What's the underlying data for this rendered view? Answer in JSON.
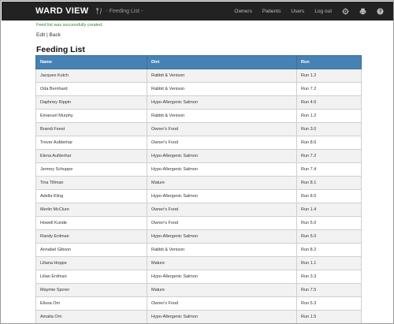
{
  "navbar": {
    "brand": "WARD VIEW",
    "breadcrumb": "- Feeding List -",
    "links": [
      "Owners",
      "Patients",
      "Users",
      "Log out"
    ]
  },
  "flash": "Feed list was successfully created.",
  "actions": {
    "edit": "Edit",
    "separator": "|",
    "back": "Back"
  },
  "page_title": "Feeding List",
  "table": {
    "headers": [
      "Name",
      "Diet",
      "Run"
    ],
    "rows": [
      [
        "Jacques Kutch",
        "Rabbit & Venison",
        "Run 1.2"
      ],
      [
        "Oda Bernhard",
        "Rabbit & Venison",
        "Run 7.2"
      ],
      [
        "Daphney Rippin",
        "Hypo-Allergenic Salmon",
        "Run 4.6"
      ],
      [
        "Emanuel Murphy",
        "Rabbit & Venison",
        "Run 1.2"
      ],
      [
        "Brandi Feest",
        "Owner's Food",
        "Run 3.0"
      ],
      [
        "Trever Aufderhar",
        "Owner's Food",
        "Run 8.6"
      ],
      [
        "Elena Aufderhar",
        "Hypo-Allergenic Salmon",
        "Run 7.2"
      ],
      [
        "Jermey Schuppe",
        "Hypo-Allergenic Salmon",
        "Run 7.4"
      ],
      [
        "Tina Tillman",
        "Mature",
        "Run 8.1"
      ],
      [
        "Adella Kling",
        "Hypo-Allergenic Salmon",
        "Run 8.5"
      ],
      [
        "Merlin McClure",
        "Owner's Food",
        "Run 1.4"
      ],
      [
        "Howell Kunde",
        "Owner's Food",
        "Run 5.0"
      ],
      [
        "Randy Erdman",
        "Hypo-Allergenic Salmon",
        "Run 5.0"
      ],
      [
        "Annabel Gibson",
        "Rabbit & Venison",
        "Run 8.2"
      ],
      [
        "Liliana Hoppe",
        "Mature",
        "Run 1.1"
      ],
      [
        "Lilian Erdman",
        "Hypo-Allergenic Salmon",
        "Run 3.3"
      ],
      [
        "Maymie Sporer",
        "Mature",
        "Run 7.5"
      ],
      [
        "Elissa Orn",
        "Owner's Food",
        "Run 5.3"
      ],
      [
        "Amalia Orn",
        "Hypo-Allergenic Salmon",
        "Run 1.5"
      ]
    ]
  },
  "colors": {
    "navbar": "#222222",
    "header": "#4682b4",
    "flash": "#2e8b2e"
  },
  "icons": [
    "cutlery-icon",
    "settings-icon",
    "print-icon",
    "help-icon"
  ]
}
